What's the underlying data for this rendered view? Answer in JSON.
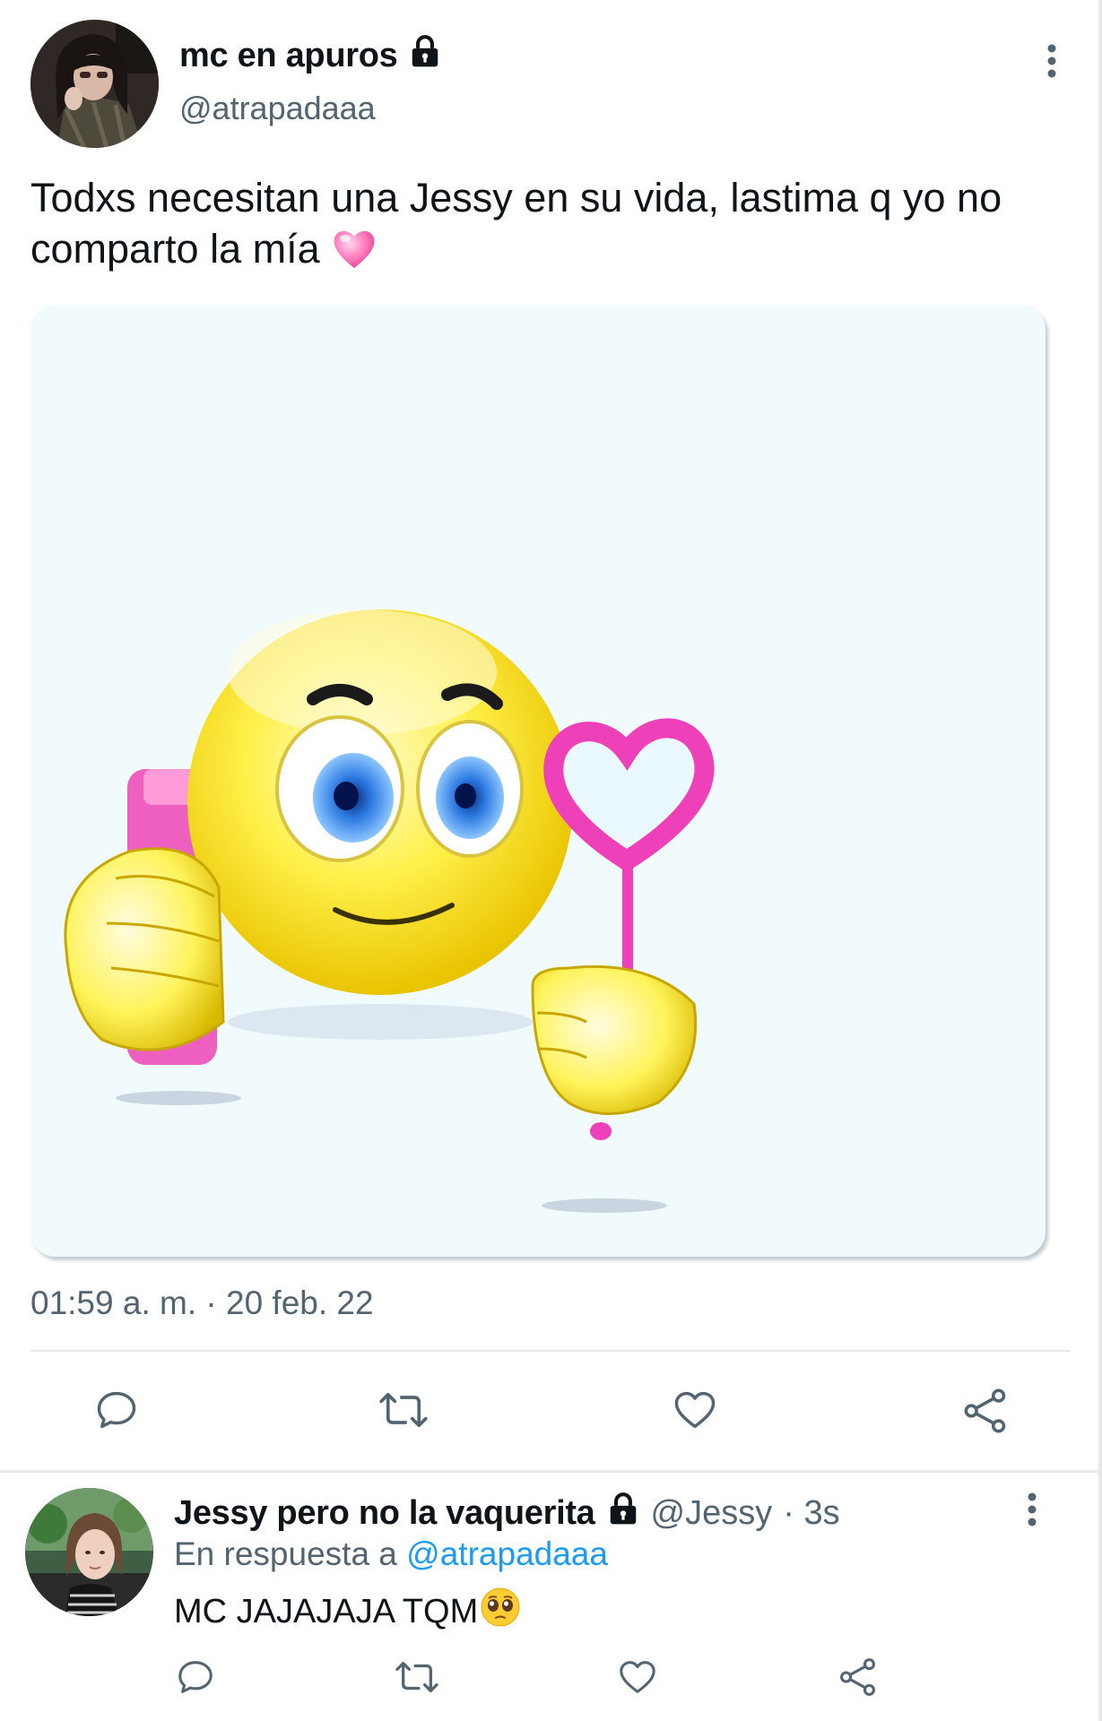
{
  "tweet": {
    "author_name": "mc en apuros",
    "author_handle": "@atrapadaaa",
    "text": "Todxs necesitan una Jessy en su vida, lastima q yo no comparto la mía",
    "text_emoji": "heart-emoji",
    "media": {
      "description_icon": "emoji-with-phone-and-heart-image"
    },
    "timestamp": "01:59 a. m. · 20 feb. 22",
    "actions": [
      "reply-icon",
      "retweet-icon",
      "like-icon",
      "share-icon"
    ]
  },
  "reply": {
    "author_name": "Jessy pero no la vaquerita",
    "author_handle": "@Jessy",
    "time": "· 3s",
    "in_reply_prefix": "En respuesta a",
    "in_reply_mention": "@atrapadaaa",
    "text": "MC JAJAJAJA TQM",
    "text_emoji": "pleading-face-emoji",
    "actions": [
      "reply-icon",
      "retweet-icon",
      "like-icon",
      "share-icon"
    ]
  },
  "colors": {
    "text_primary": "#0f1419",
    "text_secondary": "#536471",
    "link": "#1d9bf0",
    "divider": "#e6e9ec",
    "media_bg": "#f1fbfd",
    "icon_gray": "#536471"
  }
}
